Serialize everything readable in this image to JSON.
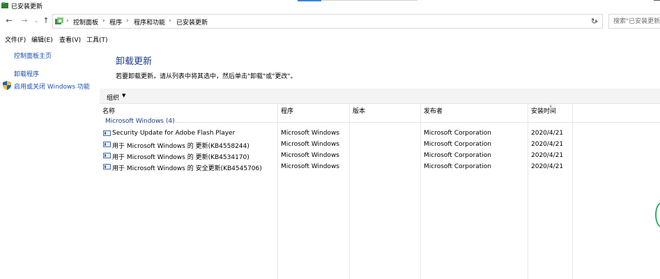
{
  "window": {
    "title": "已安装更新"
  },
  "nav": {
    "back_icon": "back-arrow-icon",
    "forward_icon": "forward-arrow-icon",
    "recent_icon": "chevron-down-icon",
    "up_icon": "up-arrow-icon"
  },
  "address": {
    "breadcrumbs": [
      "控制面板",
      "程序",
      "程序和功能",
      "已安装更新"
    ],
    "separator": "›"
  },
  "search": {
    "placeholder": "搜索\"已安装更新\""
  },
  "menu": {
    "items": [
      "文件(F)",
      "编辑(E)",
      "查看(V)",
      "工具(T)"
    ]
  },
  "sidebar": {
    "links": [
      "控制面板主页",
      "卸载程序",
      "启用或关闭 Windows 功能"
    ]
  },
  "main": {
    "heading": "卸载更新",
    "instruction": "若要卸载更新，请从列表中将其选中，然后单击\"卸载\"或\"更改\"。"
  },
  "toolbar": {
    "organize_label": "组织",
    "organize_arrow": "▼"
  },
  "table": {
    "columns": [
      "名称",
      "程序",
      "版本",
      "发布者",
      "安装时间"
    ],
    "group": "Microsoft Windows (4)",
    "rows": [
      {
        "name": "Security Update for Adobe Flash Player",
        "program": "Microsoft Windows",
        "version": "",
        "publisher": "Microsoft Corporation",
        "installed": "2020/4/21"
      },
      {
        "name": "用于 Microsoft Windows 的 更新(KB4558244)",
        "program": "Microsoft Windows",
        "version": "",
        "publisher": "Microsoft Corporation",
        "installed": "2020/4/21"
      },
      {
        "name": "用于 Microsoft Windows 的 更新(KB4534170)",
        "program": "Microsoft Windows",
        "version": "",
        "publisher": "Microsoft Corporation",
        "installed": "2020/4/21"
      },
      {
        "name": "用于 Microsoft Windows 的 安全更新(KB4545706)",
        "program": "Microsoft Windows",
        "version": "",
        "publisher": "Microsoft Corporation",
        "installed": "2020/4/21"
      }
    ]
  },
  "colors": {
    "heading": "#1e3a8a",
    "link": "#1a4fb5",
    "accent": "#3b84d6"
  }
}
